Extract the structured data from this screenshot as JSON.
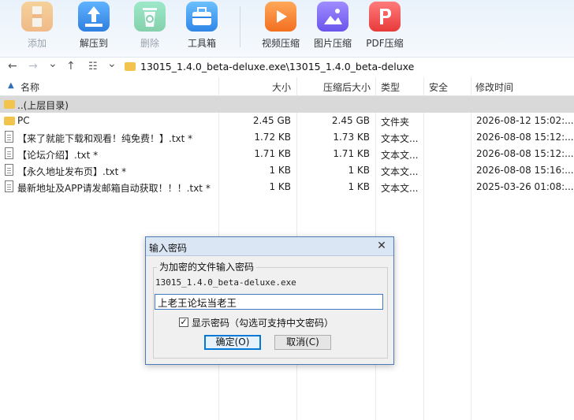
{
  "toolbar": {
    "buttons": [
      {
        "label": "添加",
        "icon": "add-archive-icon",
        "enabled": false
      },
      {
        "label": "解压到",
        "icon": "extract-to-icon",
        "enabled": true
      },
      {
        "label": "删除",
        "icon": "recycle-delete-icon",
        "enabled": false
      },
      {
        "label": "工具箱",
        "icon": "toolbox-icon",
        "enabled": true
      },
      {
        "label": "视频压缩",
        "icon": "video-compress-icon",
        "enabled": true
      },
      {
        "label": "图片压缩",
        "icon": "image-compress-icon",
        "enabled": true
      },
      {
        "label": "PDF压缩",
        "icon": "pdf-compress-icon",
        "enabled": true
      }
    ],
    "colors": {
      "orange": "#f5a03a",
      "blue": "#3a8ee8",
      "green": "#3ec27a",
      "video": "#f7862f",
      "image": "#7b6cf2",
      "pdf": "#ef4f4f"
    }
  },
  "nav": {
    "back": "←",
    "forward": "→",
    "dropdown": "⌄",
    "up": "↑",
    "view": "☷",
    "view_dropdown": "⌄"
  },
  "address": {
    "path": "13015_1.4.0_beta-deluxe.exe\\13015_1.4.0_beta-deluxe"
  },
  "columns": {
    "name": "名称",
    "size": "大小",
    "packed": "压缩后大小",
    "type": "类型",
    "security": "安全",
    "modified": "修改时间"
  },
  "rows": [
    {
      "name": "..(上层目录)",
      "kind": "folder",
      "size": "",
      "packed": "",
      "type": "",
      "modified": ""
    },
    {
      "name": "PC",
      "kind": "folder",
      "size": "2.45 GB",
      "packed": "2.45 GB",
      "type": "文件夹",
      "modified": "2026-08-12 15:02:..."
    },
    {
      "name": "【来了就能下载和观看！纯免费！】.txt *",
      "kind": "file",
      "size": "1.72 KB",
      "packed": "1.73 KB",
      "type": "文本文...",
      "modified": "2026-08-08 15:12:..."
    },
    {
      "name": "【论坛介绍】.txt *",
      "kind": "file",
      "size": "1.71 KB",
      "packed": "1.71 KB",
      "type": "文本文...",
      "modified": "2026-08-08 15:12:..."
    },
    {
      "name": "【永久地址发布页】.txt *",
      "kind": "file",
      "size": "1 KB",
      "packed": "1 KB",
      "type": "文本文...",
      "modified": "2026-08-08 15:16:..."
    },
    {
      "name": "最新地址及APP请发邮箱自动获取！！！.txt *",
      "kind": "file",
      "size": "1 KB",
      "packed": "1 KB",
      "type": "文本文...",
      "modified": "2025-03-26 01:08:..."
    }
  ],
  "dialog": {
    "title": "输入密码",
    "close": "✕",
    "group_label": "为加密的文件输入密码",
    "filename": "13015_1.4.0_beta-deluxe.exe",
    "password_value": "上老王论坛当老王",
    "show_password_checked": true,
    "check_mark": "✓",
    "show_password_label": "显示密码（勾选可支持中文密码）",
    "ok_label": "确定(O)",
    "cancel_label": "取消(C)"
  }
}
